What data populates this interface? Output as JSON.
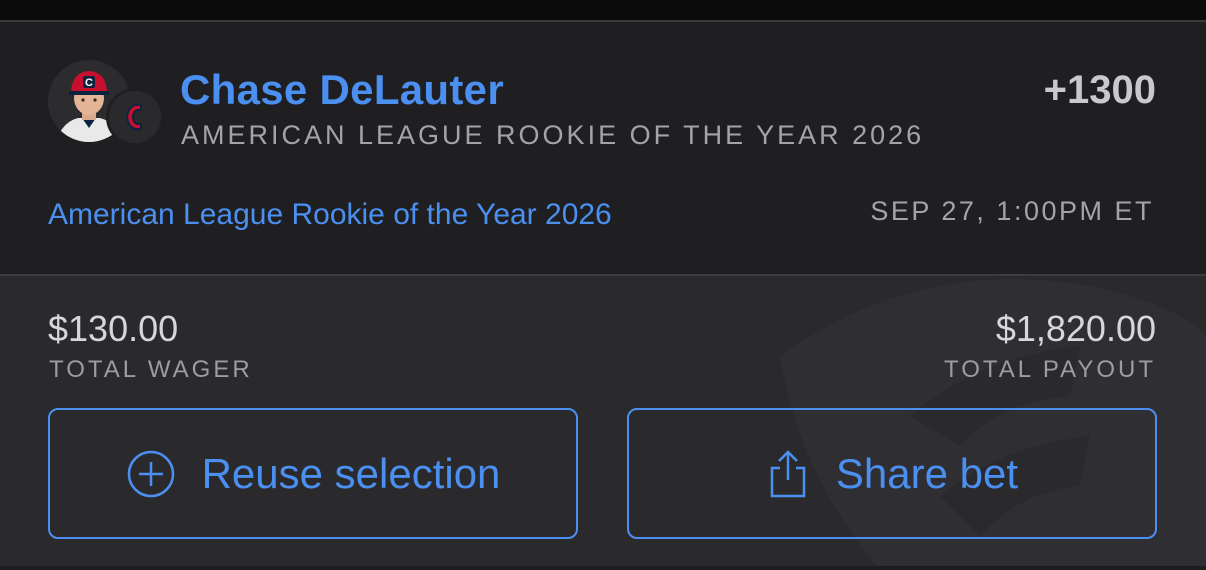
{
  "bet": {
    "player_name": "Chase DeLauter",
    "market": "AMERICAN LEAGUE ROOKIE OF THE YEAR 2026",
    "odds": "+1300",
    "event_name": "American League Rookie of the Year 2026",
    "event_time": "SEP 27, 1:00PM ET",
    "team_logo_letter": "C"
  },
  "summary": {
    "wager_amount": "$130.00",
    "wager_label": "TOTAL WAGER",
    "payout_amount": "$1,820.00",
    "payout_label": "TOTAL PAYOUT"
  },
  "actions": {
    "reuse_label": "Reuse selection",
    "reuse_icon": "plus-circle-icon",
    "share_label": "Share bet",
    "share_icon": "share-icon"
  },
  "colors": {
    "accent": "#4b8ff0",
    "header_bg": "#1f1f21",
    "summary_bg": "#2a2a2d",
    "team_red": "#c8102e",
    "team_navy": "#0c2340"
  }
}
